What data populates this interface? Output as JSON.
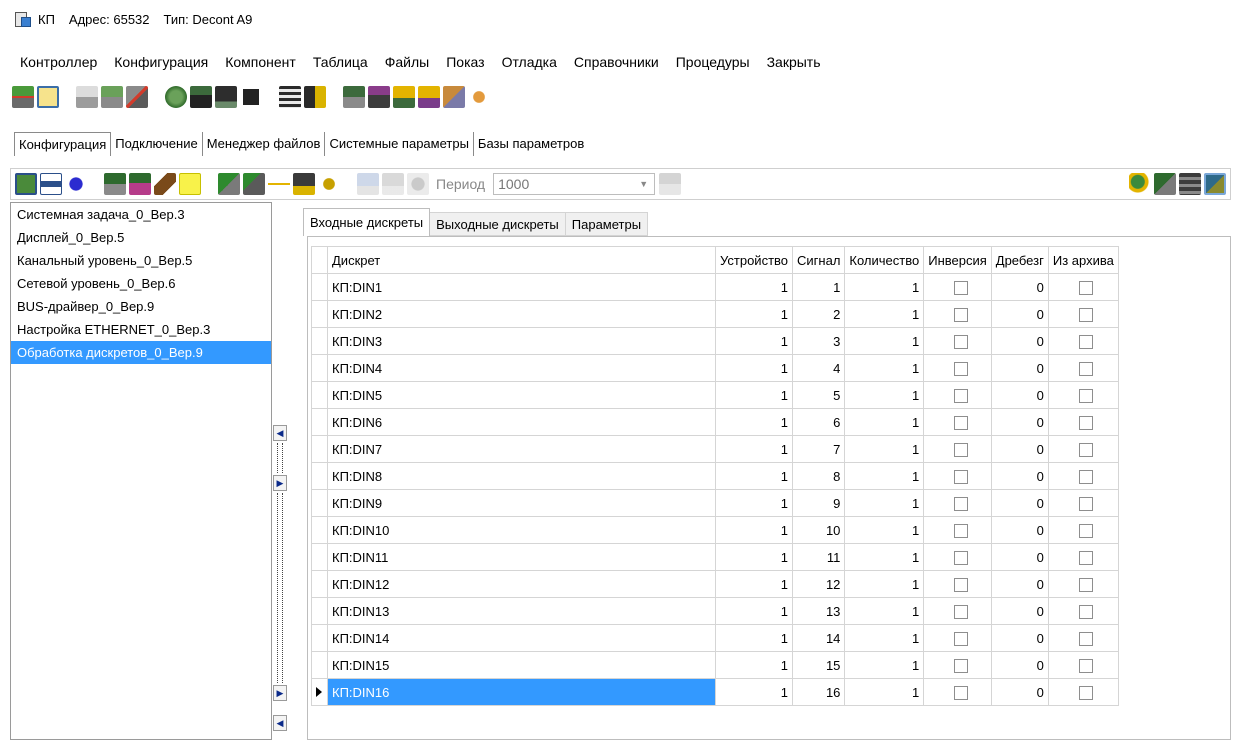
{
  "title": {
    "app": "КП",
    "address": "Адрес: 65532",
    "type": "Тип: Decont A9"
  },
  "menu": [
    "Контроллер",
    "Конфигурация",
    "Компонент",
    "Таблица",
    "Файлы",
    "Показ",
    "Отладка",
    "Справочники",
    "Процедуры",
    "Закрыть"
  ],
  "main_tabs": [
    "Конфигурация",
    "Подключение",
    "Менеджер файлов",
    "Системные параметры",
    "Базы параметров"
  ],
  "period": {
    "label": "Период",
    "value": "1000"
  },
  "components": [
    "Системная задача_0_Вер.3",
    "Дисплей_0_Вер.5",
    "Канальный уровень_0_Вер.5",
    "Сетевой уровень_0_Вер.6",
    "BUS-драйвер_0_Вер.9",
    "Настройка ETHERNET_0_Вер.3",
    "Обработка дискретов_0_Вер.9"
  ],
  "selected_component": "Обработка дискретов_0_Вер.9",
  "sub_tabs": [
    "Входные дискреты",
    "Выходные дискреты",
    "Параметры"
  ],
  "table": {
    "headers": [
      "Дискрет",
      "Устройство",
      "Сигнал",
      "Количество",
      "Инверсия",
      "Дребезг",
      "Из архива"
    ],
    "rows": [
      {
        "name": "КП:DIN1",
        "device": "1",
        "signal": "1",
        "count": "1",
        "debounce": "0"
      },
      {
        "name": "КП:DIN2",
        "device": "1",
        "signal": "2",
        "count": "1",
        "debounce": "0"
      },
      {
        "name": "КП:DIN3",
        "device": "1",
        "signal": "3",
        "count": "1",
        "debounce": "0"
      },
      {
        "name": "КП:DIN4",
        "device": "1",
        "signal": "4",
        "count": "1",
        "debounce": "0"
      },
      {
        "name": "КП:DIN5",
        "device": "1",
        "signal": "5",
        "count": "1",
        "debounce": "0"
      },
      {
        "name": "КП:DIN6",
        "device": "1",
        "signal": "6",
        "count": "1",
        "debounce": "0"
      },
      {
        "name": "КП:DIN7",
        "device": "1",
        "signal": "7",
        "count": "1",
        "debounce": "0"
      },
      {
        "name": "КП:DIN8",
        "device": "1",
        "signal": "8",
        "count": "1",
        "debounce": "0"
      },
      {
        "name": "КП:DIN9",
        "device": "1",
        "signal": "9",
        "count": "1",
        "debounce": "0"
      },
      {
        "name": "КП:DIN10",
        "device": "1",
        "signal": "10",
        "count": "1",
        "debounce": "0"
      },
      {
        "name": "КП:DIN11",
        "device": "1",
        "signal": "11",
        "count": "1",
        "debounce": "0"
      },
      {
        "name": "КП:DIN12",
        "device": "1",
        "signal": "12",
        "count": "1",
        "debounce": "0"
      },
      {
        "name": "КП:DIN13",
        "device": "1",
        "signal": "13",
        "count": "1",
        "debounce": "0"
      },
      {
        "name": "КП:DIN14",
        "device": "1",
        "signal": "14",
        "count": "1",
        "debounce": "0"
      },
      {
        "name": "КП:DIN15",
        "device": "1",
        "signal": "15",
        "count": "1",
        "debounce": "0"
      },
      {
        "name": "КП:DIN16",
        "device": "1",
        "signal": "16",
        "count": "1",
        "debounce": "0"
      }
    ],
    "selected_row": "КП:DIN16"
  },
  "toolbar1_icons": [
    "connect-icon",
    "envelope-icon",
    "controller-gray-icon",
    "controller-config-icon",
    "controller-delete-icon",
    "recycle-icon",
    "device-icon",
    "terminal-icon",
    "stop-icon",
    "table-icon",
    "table-edit-icon",
    "db-icon",
    "db-edit-icon",
    "folder-icon",
    "folder-save-icon",
    "tools-icon",
    "users-icon"
  ],
  "toolbar2_icons": [
    "add-component-icon",
    "link-icon",
    "square-icon",
    "component-icon",
    "component-add-icon",
    "edit-pen-icon",
    "play-icon",
    "copy-icon",
    "paste-icon",
    "insert-icon",
    "clipboard-icon",
    "small-square-icon",
    "monitor-icon",
    "monitor-off-icon",
    "schedule-icon",
    "print-icon",
    "search-icon",
    "module-icon",
    "stack-icon",
    "grid-view-icon"
  ],
  "colors": {
    "selection": "#3399ff"
  }
}
